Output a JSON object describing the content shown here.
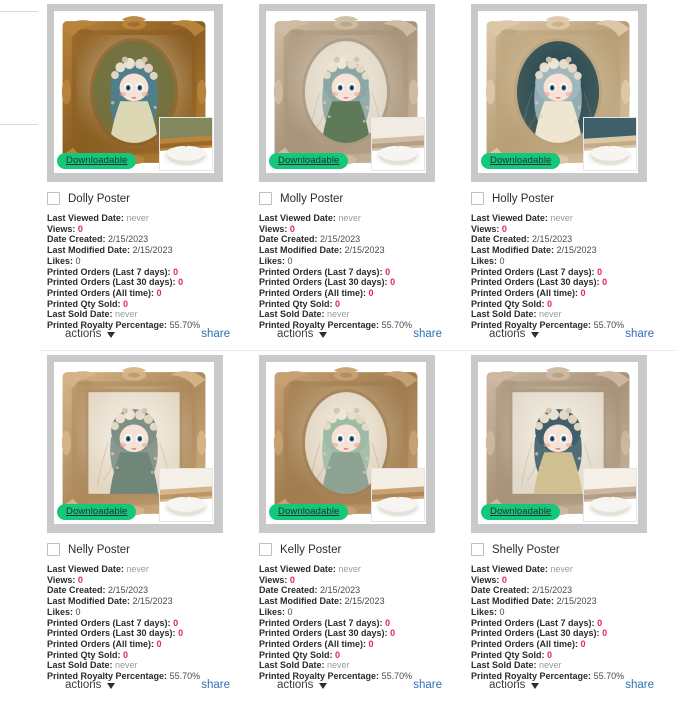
{
  "left_rail": {
    "dividers": 2
  },
  "labels": {
    "last_viewed_date": "Last Viewed Date:",
    "views": "Views:",
    "date_created": "Date Created:",
    "last_modified_date": "Last Modified Date:",
    "likes": "Likes:",
    "printed_orders_7": "Printed Orders (Last 7 days):",
    "printed_orders_30": "Printed Orders (Last 30 days):",
    "printed_orders_all": "Printed Orders (All time):",
    "printed_qty_sold": "Printed Qty Sold:",
    "last_sold_date": "Last Sold Date:",
    "printed_royalty_percentage": "Printed Royalty Percentage:"
  },
  "footer": {
    "actions_label": "actions",
    "share_label": "share"
  },
  "badge_label": "Downloadable",
  "colors": {
    "badge_green": "#14c87a",
    "value_red": "#e0245e",
    "share_blue": "#2f6fb5",
    "muted_gray": "#9a9a9a",
    "thumb_border_gray": "#c9c9c9"
  },
  "cards": [
    {
      "title": "Dolly Poster",
      "badge": "Downloadable",
      "art": "ornate-gold-frame-blue-hair-doll-portrait",
      "last_viewed_date": "never",
      "views": "0",
      "date_created": "2/15/2023",
      "last_modified_date": "2/15/2023",
      "likes": "0",
      "printed_orders_7": "0",
      "printed_orders_30": "0",
      "printed_orders_all": "0",
      "printed_qty_sold": "0",
      "last_sold_date": "never",
      "printed_royalty_percentage": "55.70%",
      "frame_color": "#b9853c",
      "frame_color_dark": "#8a5d21",
      "mat_color": "#f3efe0",
      "oval_color": "#6d7242",
      "hair_color": "#4f7f8d",
      "dress_color": "#ddd8b4"
    },
    {
      "title": "Molly Poster",
      "badge": "Downloadable",
      "art": "carved-beige-frame-teal-hair-doll-portrait",
      "last_viewed_date": "never",
      "views": "0",
      "date_created": "2/15/2023",
      "last_modified_date": "2/15/2023",
      "likes": "0",
      "printed_orders_7": "0",
      "printed_orders_30": "0",
      "printed_orders_all": "0",
      "printed_qty_sold": "0",
      "last_sold_date": "never",
      "printed_royalty_percentage": "55.70%",
      "frame_color": "#cfbda4",
      "frame_color_dark": "#a9947a",
      "mat_color": "#f6f2e6",
      "oval_color": "#eee9dc",
      "hair_color": "#8aa7a4",
      "dress_color": "#5e7a58"
    },
    {
      "title": "Holly Poster",
      "badge": "Downloadable",
      "art": "ivory-rococo-frame-dark-teal-background-doll-portrait",
      "last_viewed_date": "never",
      "views": "0",
      "date_created": "2/15/2023",
      "last_modified_date": "2/15/2023",
      "likes": "0",
      "printed_orders_7": "0",
      "printed_orders_30": "0",
      "printed_orders_all": "0",
      "printed_qty_sold": "0",
      "last_sold_date": "never",
      "printed_royalty_percentage": "55.70%",
      "frame_color": "#ddc9a8",
      "frame_color_dark": "#b89f77",
      "mat_color": "#e7d9bc",
      "oval_color": "#1d4450",
      "hair_color": "#9fb7bd",
      "dress_color": "#efe6d2"
    },
    {
      "title": "Nelly Poster",
      "badge": "Downloadable",
      "art": "light-wood-frame-cat-hood-doll-full-body",
      "last_viewed_date": "never",
      "views": "0",
      "date_created": "2/15/2023",
      "last_modified_date": "2/15/2023",
      "likes": "0",
      "printed_orders_7": "0",
      "printed_orders_30": "0",
      "printed_orders_all": "0",
      "printed_qty_sold": "0",
      "last_sold_date": "never",
      "printed_royalty_percentage": "55.70%",
      "frame_color": "#d7b588",
      "frame_color_dark": "#ad8a5d",
      "mat_color": "#f2ece0",
      "oval_color": "#f4efe4",
      "hair_color": "#7e8f86",
      "dress_color": "#6f8679"
    },
    {
      "title": "Kelly Poster",
      "badge": "Downloadable",
      "art": "carved-oval-frame-floral-bonnet-doll-with-bird",
      "last_viewed_date": "never",
      "views": "0",
      "date_created": "2/15/2023",
      "last_modified_date": "2/15/2023",
      "likes": "0",
      "printed_orders_7": "0",
      "printed_orders_30": "0",
      "printed_orders_all": "0",
      "printed_qty_sold": "0",
      "last_sold_date": "never",
      "printed_royalty_percentage": "55.70%",
      "frame_color": "#c9a274",
      "frame_color_dark": "#a07c4f",
      "mat_color": "#e6dcc4",
      "oval_color": "#f2ece0",
      "hair_color": "#9dbba6",
      "dress_color": "#8fa394"
    },
    {
      "title": "Shelly Poster",
      "badge": "Downloadable",
      "art": "pale-stone-frame-teal-hair-doll-with-flowers",
      "last_viewed_date": "never",
      "views": "0",
      "date_created": "2/15/2023",
      "last_modified_date": "2/15/2023",
      "likes": "0",
      "printed_orders_7": "0",
      "printed_orders_30": "0",
      "printed_orders_all": "0",
      "printed_qty_sold": "0",
      "last_sold_date": "never",
      "printed_royalty_percentage": "55.70%",
      "frame_color": "#cdb9a2",
      "frame_color_dark": "#a8937a",
      "mat_color": "#efe8d8",
      "oval_color": "#f3eee2",
      "hair_color": "#3f5f6b",
      "dress_color": "#cfc091"
    }
  ]
}
